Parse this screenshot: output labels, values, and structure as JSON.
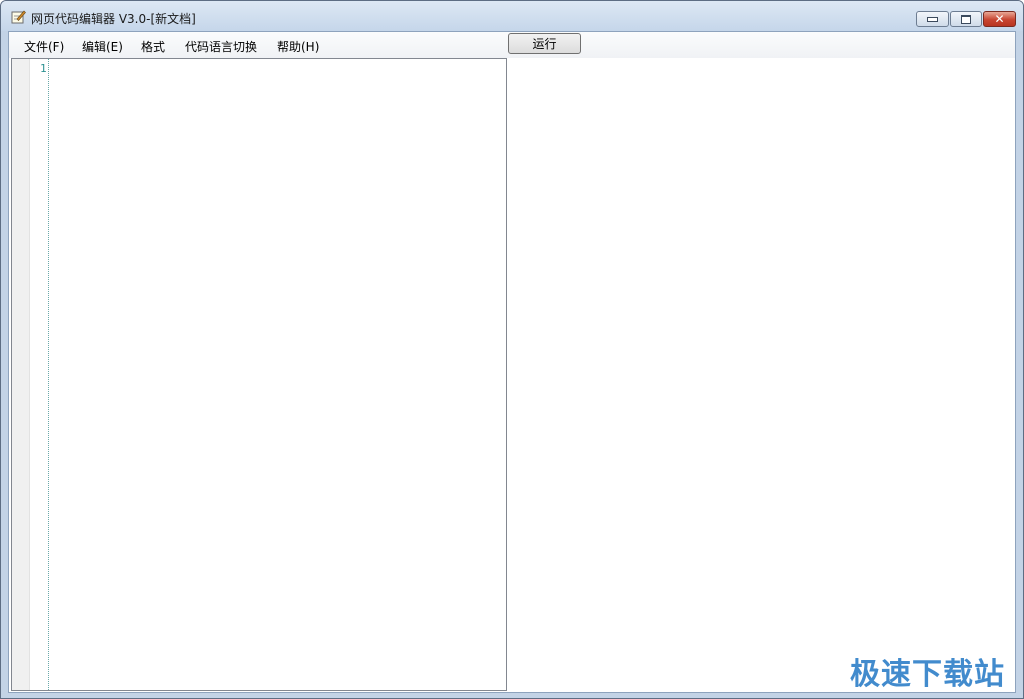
{
  "window": {
    "title": "网页代码编辑器 V3.0-[新文档]",
    "icon": "notepad-pen-icon"
  },
  "controls": {
    "minimize_icon": "minimize-icon",
    "maximize_icon": "maximize-icon",
    "close_icon": "close-icon",
    "close_glyph": "✕"
  },
  "menu": {
    "items": [
      {
        "label": "文件(F)"
      },
      {
        "label": "编辑(E)"
      },
      {
        "label": "格式"
      },
      {
        "label": "代码语言切换"
      },
      {
        "label": "帮助(H)"
      }
    ],
    "run_label": "运行"
  },
  "editor": {
    "line_numbers": [
      "1"
    ],
    "content": ""
  },
  "watermark": "极速下载站",
  "colors": {
    "line_number": "#2b9191",
    "watermark": "#2e7fc8",
    "titlebar": "#c5d6ea"
  }
}
